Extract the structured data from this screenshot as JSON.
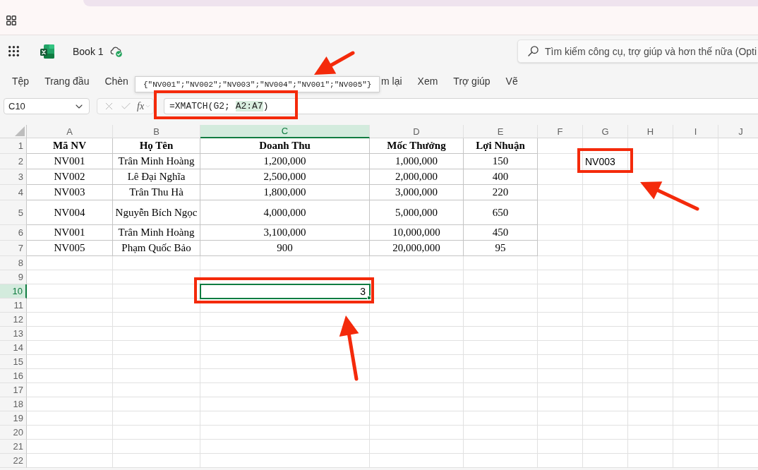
{
  "app_bar": {
    "title": "Book 1",
    "search": {
      "placeholder": "Tìm kiếm công cụ, trợ giúp và hơn thế nữa (Opti"
    }
  },
  "ribbon": {
    "tabs_left": [
      "Tệp",
      "Trang đầu",
      "Chèn"
    ],
    "tabs_right": [
      "m lại",
      "Xem",
      "Trợ giúp",
      "Vẽ"
    ]
  },
  "tooltip": {
    "text": "{\"NV001\";\"NV002\";\"NV003\";\"NV004\";\"NV001\";\"NV005\"}"
  },
  "formula_bar": {
    "name_box": "C10",
    "function_button": "fx",
    "formula": [
      {
        "text": "=XMATCH(G2; ",
        "highlighted": false
      },
      {
        "text": "A2:A7",
        "highlighted": true
      },
      {
        "text": ")",
        "highlighted": false
      }
    ],
    "callout": true
  },
  "sheet": {
    "columns": [
      {
        "label": "A",
        "selected": false
      },
      {
        "label": "B",
        "selected": false
      },
      {
        "label": "C",
        "selected": true
      },
      {
        "label": "D",
        "selected": false
      },
      {
        "label": "E",
        "selected": false
      },
      {
        "label": "F",
        "selected": false
      },
      {
        "label": "G",
        "selected": false
      },
      {
        "label": "H",
        "selected": false
      },
      {
        "label": "I",
        "selected": false
      },
      {
        "label": "J",
        "selected": false
      }
    ],
    "rows": [
      {
        "label": "1",
        "selected": false
      },
      {
        "label": "2",
        "selected": false
      },
      {
        "label": "3",
        "selected": false
      },
      {
        "label": "4",
        "selected": false
      },
      {
        "label": "5",
        "selected": false
      },
      {
        "label": "6",
        "selected": false
      },
      {
        "label": "7",
        "selected": false
      },
      {
        "label": "8",
        "selected": false
      },
      {
        "label": "9",
        "selected": false
      },
      {
        "label": "10",
        "selected": true
      },
      {
        "label": "11",
        "selected": false
      },
      {
        "label": "12",
        "selected": false
      },
      {
        "label": "13",
        "selected": false
      },
      {
        "label": "14",
        "selected": false
      },
      {
        "label": "15",
        "selected": false
      },
      {
        "label": "16",
        "selected": false
      },
      {
        "label": "17",
        "selected": false
      },
      {
        "label": "18",
        "selected": false
      },
      {
        "label": "19",
        "selected": false
      },
      {
        "label": "20",
        "selected": false
      },
      {
        "label": "21",
        "selected": false
      },
      {
        "label": "22",
        "selected": false
      }
    ],
    "table": {
      "header": [
        "Mã NV",
        "Họ Tên",
        "Doanh Thu",
        "Mốc Thưởng",
        "Lợi Nhuận"
      ],
      "rows": [
        [
          "NV001",
          "Trân Minh Hoàng",
          "1,200,000",
          "1,000,000",
          "150"
        ],
        [
          "NV002",
          "Lê Đại Nghĩa",
          "2,500,000",
          "2,000,000",
          "400"
        ],
        [
          "NV003",
          "Trân Thu Hà",
          "1,800,000",
          "3,000,000",
          "220"
        ],
        [
          "NV004",
          "Nguyễn Bích Ngọc",
          "4,000,000",
          "5,000,000",
          "650"
        ],
        [
          "NV001",
          "Trân Minh Hoàng",
          "3,100,000",
          "10,000,000",
          "450"
        ],
        [
          "NV005",
          "Phạm Quốc Bảo",
          "900",
          "20,000,000",
          "95"
        ]
      ]
    },
    "lookup_cell": {
      "value": "NV003",
      "callout": true
    },
    "result_cell": {
      "value": "3",
      "selected": true,
      "callout": true
    }
  }
}
